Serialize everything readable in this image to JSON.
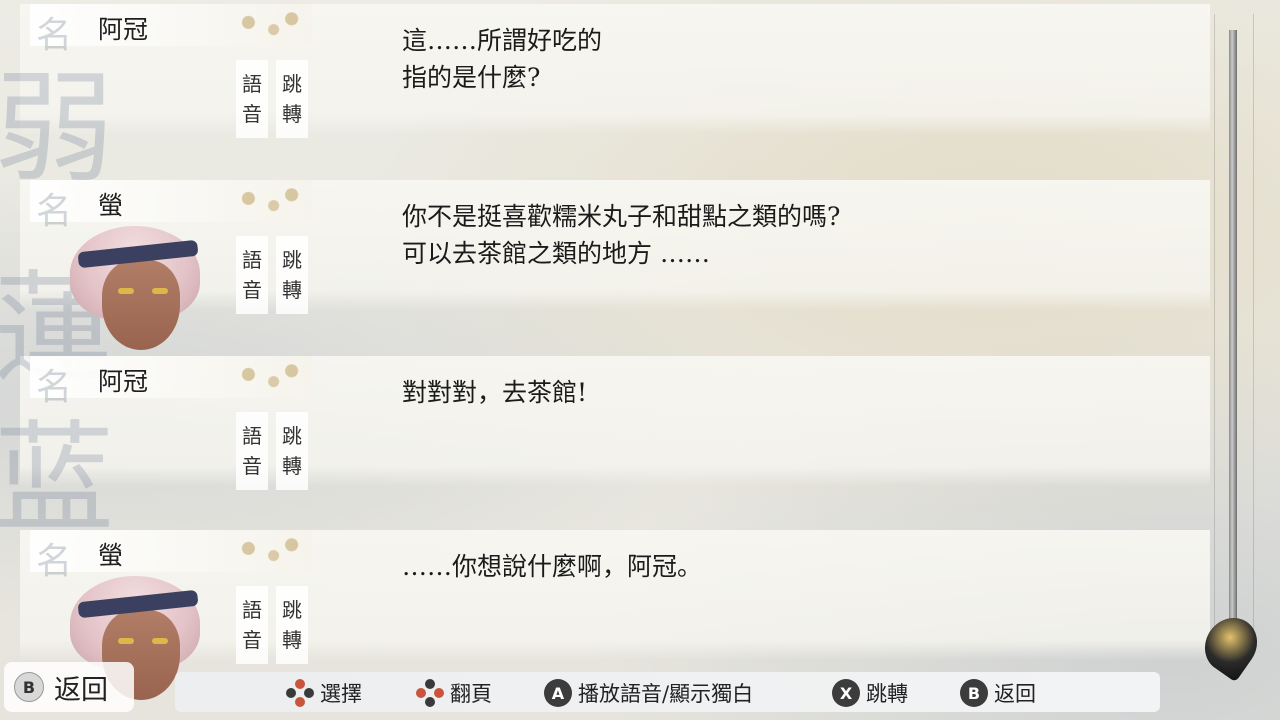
{
  "entries": [
    {
      "speaker": "阿冠",
      "ghost": "名",
      "voice": [
        "語",
        "音"
      ],
      "jump": [
        "跳",
        "轉"
      ],
      "has_portrait": false,
      "lines": [
        "這……所謂好吃的",
        "指的是什麼?"
      ]
    },
    {
      "speaker": "螢",
      "ghost": "名",
      "voice": [
        "語",
        "音"
      ],
      "jump": [
        "跳",
        "轉"
      ],
      "has_portrait": true,
      "lines": [
        "你不是挺喜歡糯米丸子和甜點之類的嗎?",
        "可以去茶館之類的地方 ……"
      ]
    },
    {
      "speaker": "阿冠",
      "ghost": "名",
      "voice": [
        "語",
        "音"
      ],
      "jump": [
        "跳",
        "轉"
      ],
      "has_portrait": false,
      "lines": [
        "對對對，去茶館!"
      ]
    },
    {
      "speaker": "螢",
      "ghost": "名",
      "voice": [
        "語",
        "音"
      ],
      "jump": [
        "跳",
        "轉"
      ],
      "has_portrait": true,
      "lines": [
        "……你想說什麼啊，阿冠。"
      ]
    }
  ],
  "footer": {
    "back_button": {
      "glyph": "B",
      "label": "返回"
    },
    "hints": [
      {
        "icon": "dpad-up-down",
        "label": "選擇"
      },
      {
        "icon": "dpad-left-right",
        "label": "翻頁"
      },
      {
        "glyph": "A",
        "label": "播放語音/顯示獨白"
      },
      {
        "glyph": "X",
        "label": "跳轉"
      },
      {
        "glyph": "B",
        "label": "返回"
      }
    ]
  },
  "background_kanji": [
    "弱",
    "蓮",
    "蓝"
  ]
}
